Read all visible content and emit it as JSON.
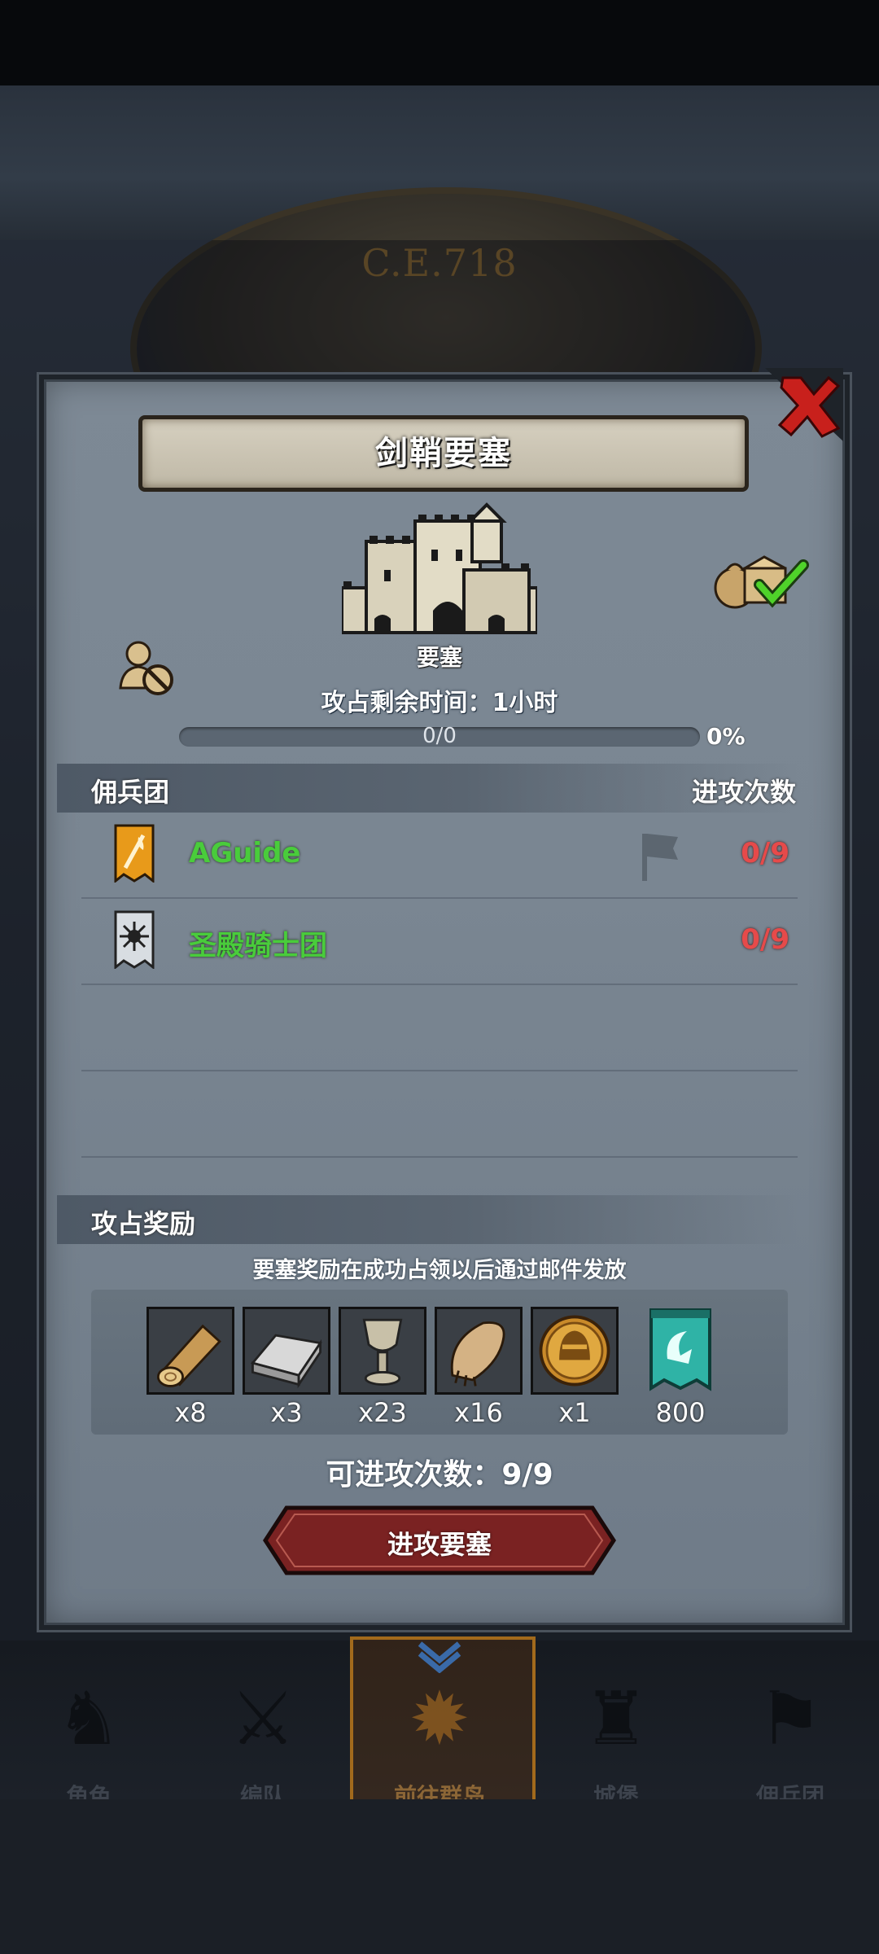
{
  "scene": {
    "year": "C.E.718"
  },
  "dialog": {
    "title": "剑鞘要塞",
    "building_type": "要塞",
    "remaining_time": "攻占剩余时间：1小时",
    "progress": {
      "text": "0/0",
      "percent_text": "0%",
      "fraction": 0.0
    },
    "icons": {
      "close": "close-icon",
      "loot": "loot-claimed-icon",
      "user_ban": "user-ban-icon"
    }
  },
  "mercenary_section": {
    "heading": "佣兵团",
    "column_attacks": "进攻次数",
    "rows": [
      {
        "name": "AGuide",
        "attacks": "0/9",
        "banner": "orange-quill-banner",
        "flag": true
      },
      {
        "name": "圣殿骑士团",
        "attacks": "0/9",
        "banner": "silver-sun-banner",
        "flag": false
      }
    ]
  },
  "reward_section": {
    "heading": "攻占奖励",
    "note": "要塞奖励在成功占领以后通过邮件发放",
    "items": [
      {
        "icon": "wood-log-icon",
        "qty": "x8"
      },
      {
        "icon": "iron-ingot-icon",
        "qty": "x3"
      },
      {
        "icon": "goblet-icon",
        "qty": "x23"
      },
      {
        "icon": "fur-pelt-icon",
        "qty": "x16"
      },
      {
        "icon": "knight-helmet-coin-icon",
        "qty": "x1"
      },
      {
        "icon": "guild-banner-icon",
        "qty": "800"
      }
    ]
  },
  "attacks_available": "可进攻次数：9/9",
  "attack_button": "进攻要塞",
  "bottom_nav": [
    {
      "label": "角色",
      "icon": "character-icon"
    },
    {
      "label": "编队",
      "icon": "formation-icon"
    },
    {
      "label": "前往群岛",
      "icon": "islands-icon",
      "active": true
    },
    {
      "label": "城堡",
      "icon": "castle-icon"
    },
    {
      "label": "佣兵团",
      "icon": "mercenary-icon"
    }
  ],
  "colors": {
    "accent_green": "#49cc3b",
    "count_red": "#e64a4a",
    "button_red": "#7a2222"
  }
}
